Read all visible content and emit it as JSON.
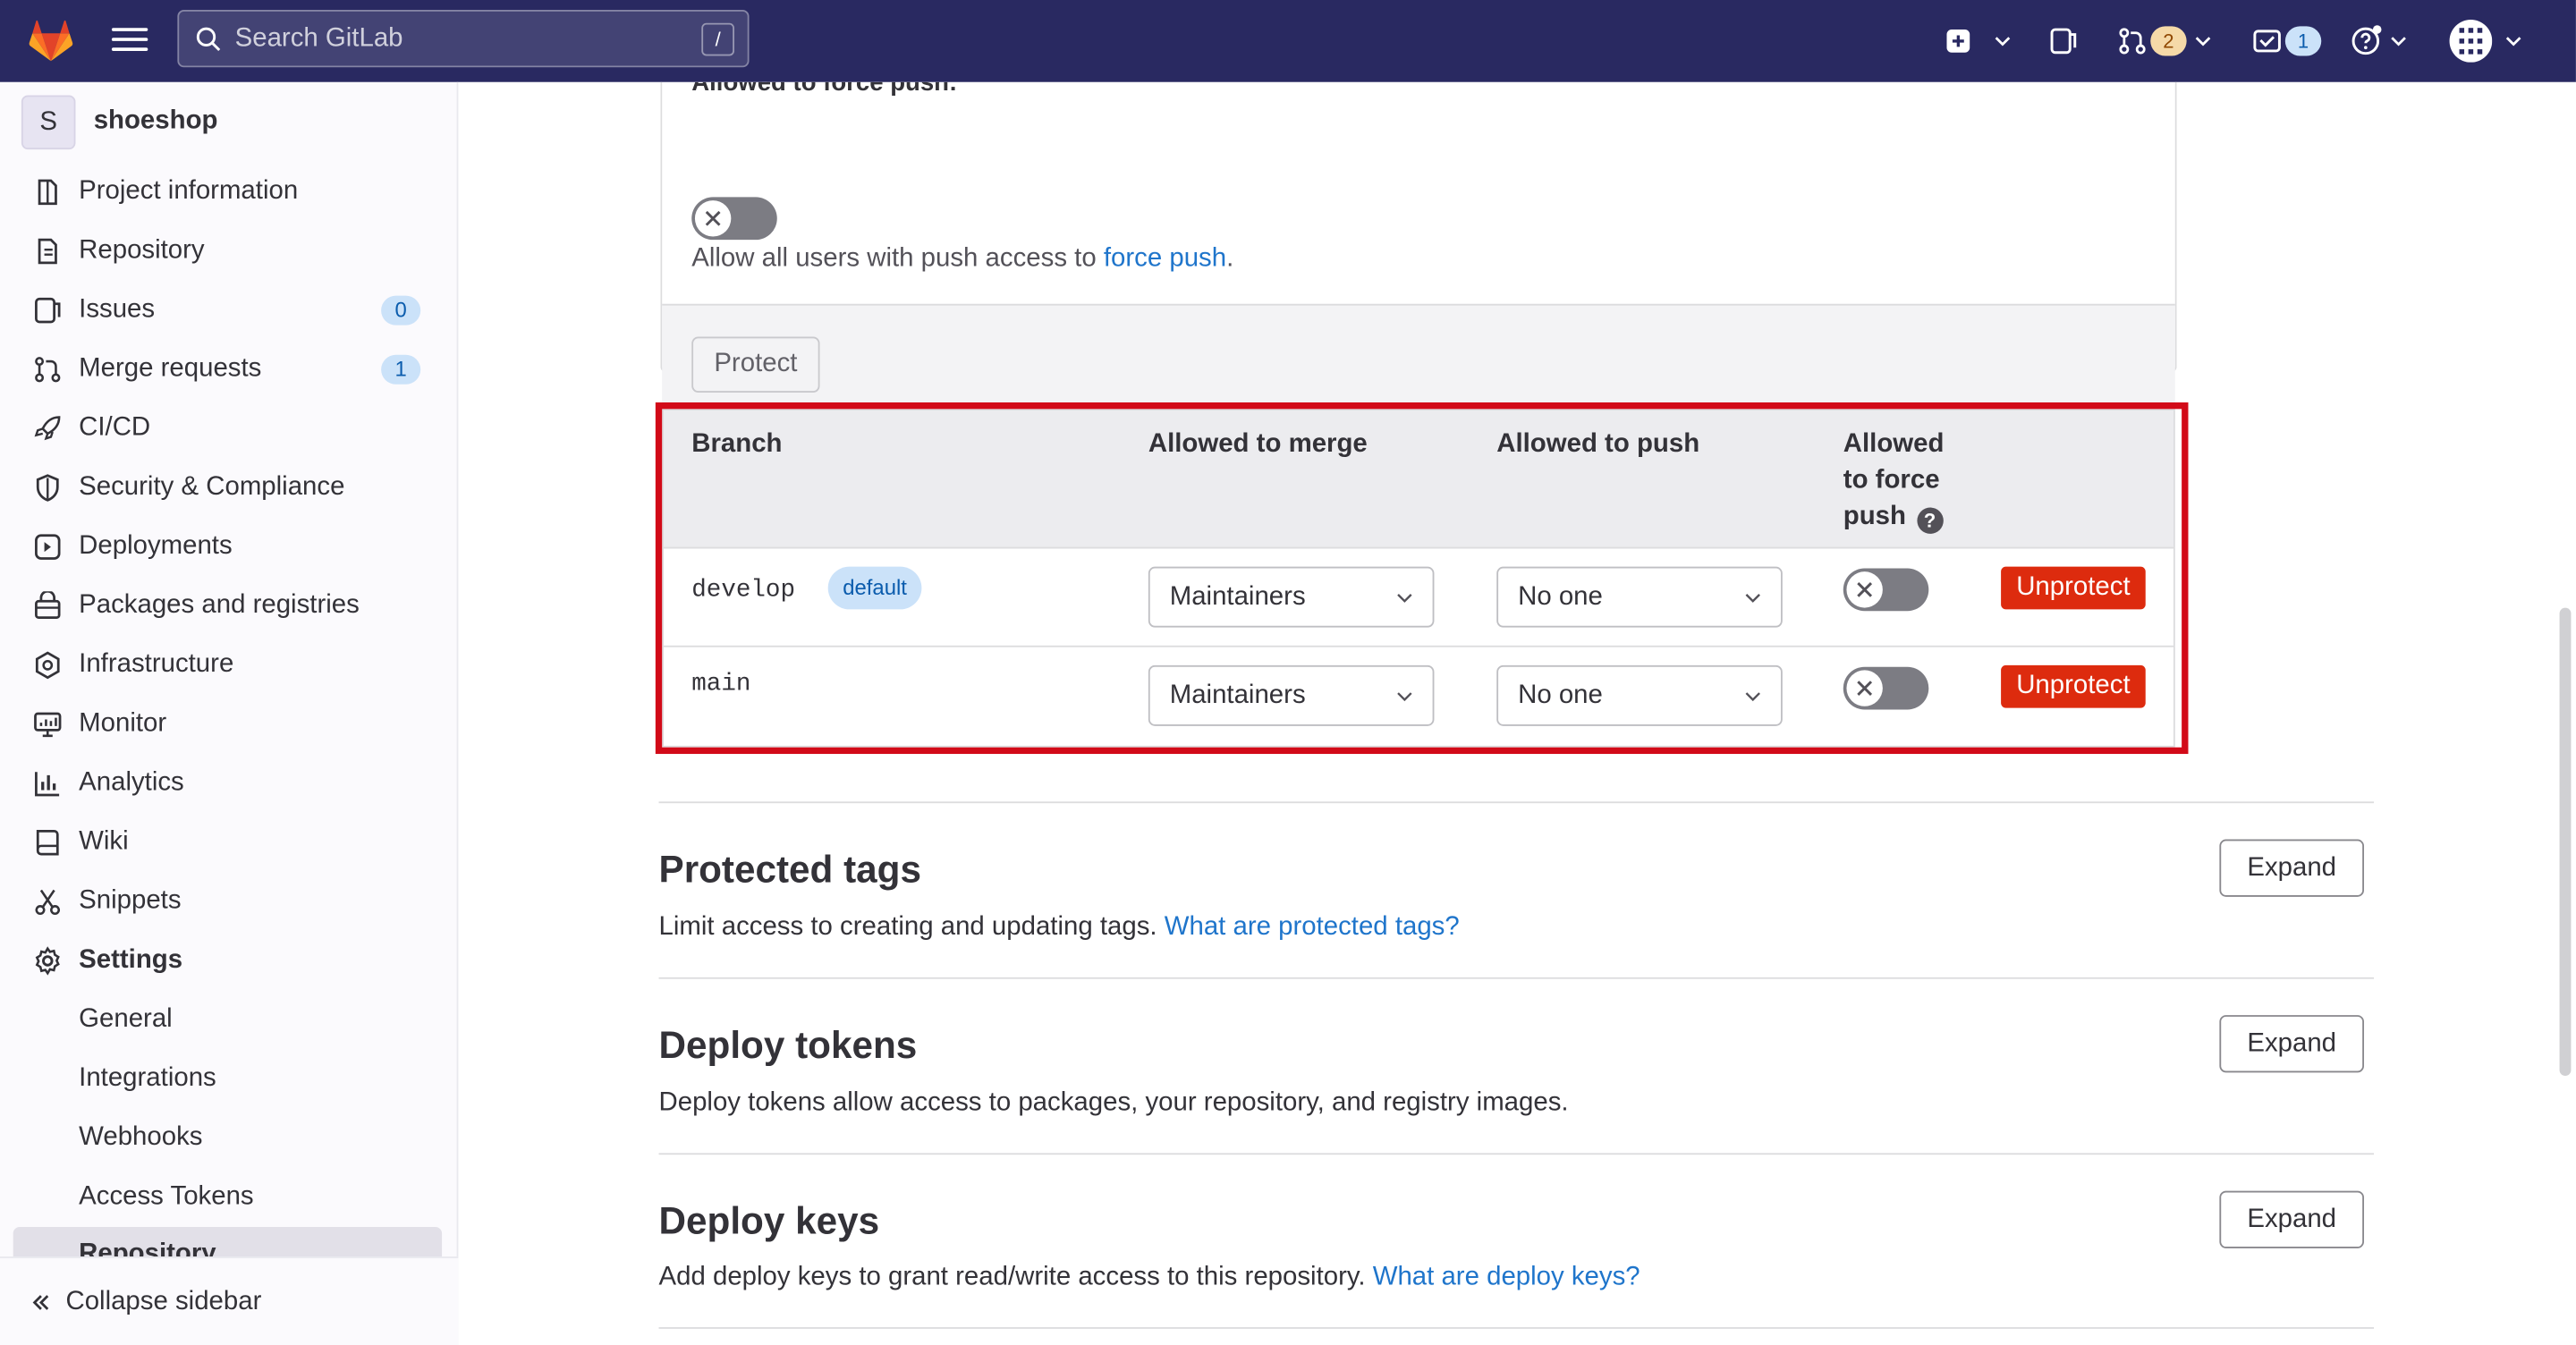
{
  "topbar": {
    "search_placeholder": "Search GitLab",
    "search_shortcut": "/",
    "merge_requests_count": "2",
    "todos_count": "1"
  },
  "sidebar": {
    "project_initial": "S",
    "project_name": "shoeshop",
    "items": [
      {
        "label": "Project information"
      },
      {
        "label": "Repository"
      },
      {
        "label": "Issues",
        "count": "0"
      },
      {
        "label": "Merge requests",
        "count": "1"
      },
      {
        "label": "CI/CD"
      },
      {
        "label": "Security & Compliance"
      },
      {
        "label": "Deployments"
      },
      {
        "label": "Packages and registries"
      },
      {
        "label": "Infrastructure"
      },
      {
        "label": "Monitor"
      },
      {
        "label": "Analytics"
      },
      {
        "label": "Wiki"
      },
      {
        "label": "Snippets"
      },
      {
        "label": "Settings"
      }
    ],
    "settings_sub": [
      "General",
      "Integrations",
      "Webhooks",
      "Access Tokens",
      "Repository"
    ],
    "collapse_label": "Collapse sidebar"
  },
  "protect_form": {
    "force_push_label": "Allowed to force push:",
    "help_prefix": "Allow all users with push access to ",
    "help_link": "force push",
    "help_suffix": ".",
    "protect_button": "Protect"
  },
  "protected_branches": {
    "columns": [
      "Branch",
      "Allowed to merge",
      "Allowed to push",
      "Allowed to force push"
    ],
    "rows": [
      {
        "branch": "develop",
        "badge": "default",
        "merge": "Maintainers",
        "push": "No one",
        "action": "Unprotect"
      },
      {
        "branch": "main",
        "badge": "",
        "merge": "Maintainers",
        "push": "No one",
        "action": "Unprotect"
      }
    ]
  },
  "sections": [
    {
      "title": "Protected tags",
      "desc": "Limit access to creating and updating tags. ",
      "link": "What are protected tags?",
      "button": "Expand"
    },
    {
      "title": "Deploy tokens",
      "desc": "Deploy tokens allow access to packages, your repository, and registry images.",
      "link": "",
      "button": "Expand"
    },
    {
      "title": "Deploy keys",
      "desc": "Add deploy keys to grant read/write access to this repository. ",
      "link": "What are deploy keys?",
      "button": "Expand"
    }
  ],
  "colors": {
    "topbar": "#292961",
    "highlight": "#d20a18",
    "danger": "#dd2b0e",
    "link": "#1f75cb"
  }
}
